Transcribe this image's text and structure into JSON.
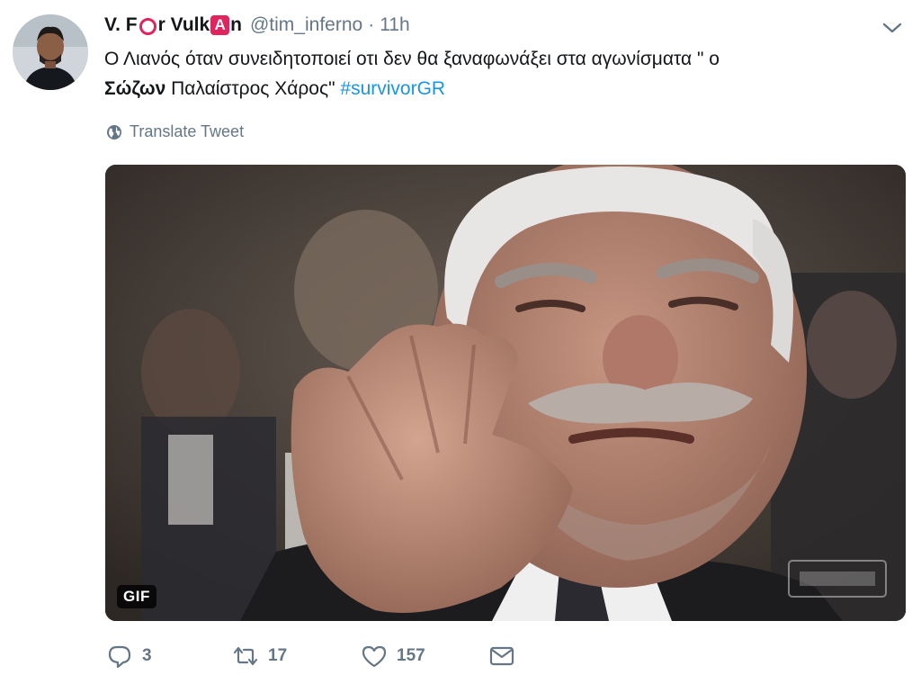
{
  "tweet": {
    "display_name_parts": [
      "V. F",
      "r Vulk",
      "n"
    ],
    "display_name_badge_letter": "A",
    "handle": "@tim_inferno",
    "separator": "·",
    "time": "11h",
    "text": {
      "line_part1": "Ο Λιανός όταν συνειδητοποιεί οτι δεν θα ξαναφωνάξει στα αγωνίσματα \" ο",
      "bold_word": "Σώζων",
      "line_part2": " Παλαίστρος Χάρος\" ",
      "hashtag": "#survivorGR"
    },
    "translate_label": "Translate Tweet",
    "media": {
      "badge": "GIF"
    },
    "actions": {
      "reply_count": "3",
      "retweet_count": "17",
      "like_count": "157"
    },
    "icons": {
      "caret": "chevron-down-icon",
      "translate": "globe-icon",
      "reply": "reply-icon",
      "retweet": "retweet-icon",
      "like": "heart-icon",
      "dm": "envelope-icon"
    },
    "colors": {
      "text": "#14171a",
      "secondary": "#657786",
      "link": "#1b95e0",
      "badge_red": "#e0245e"
    }
  }
}
